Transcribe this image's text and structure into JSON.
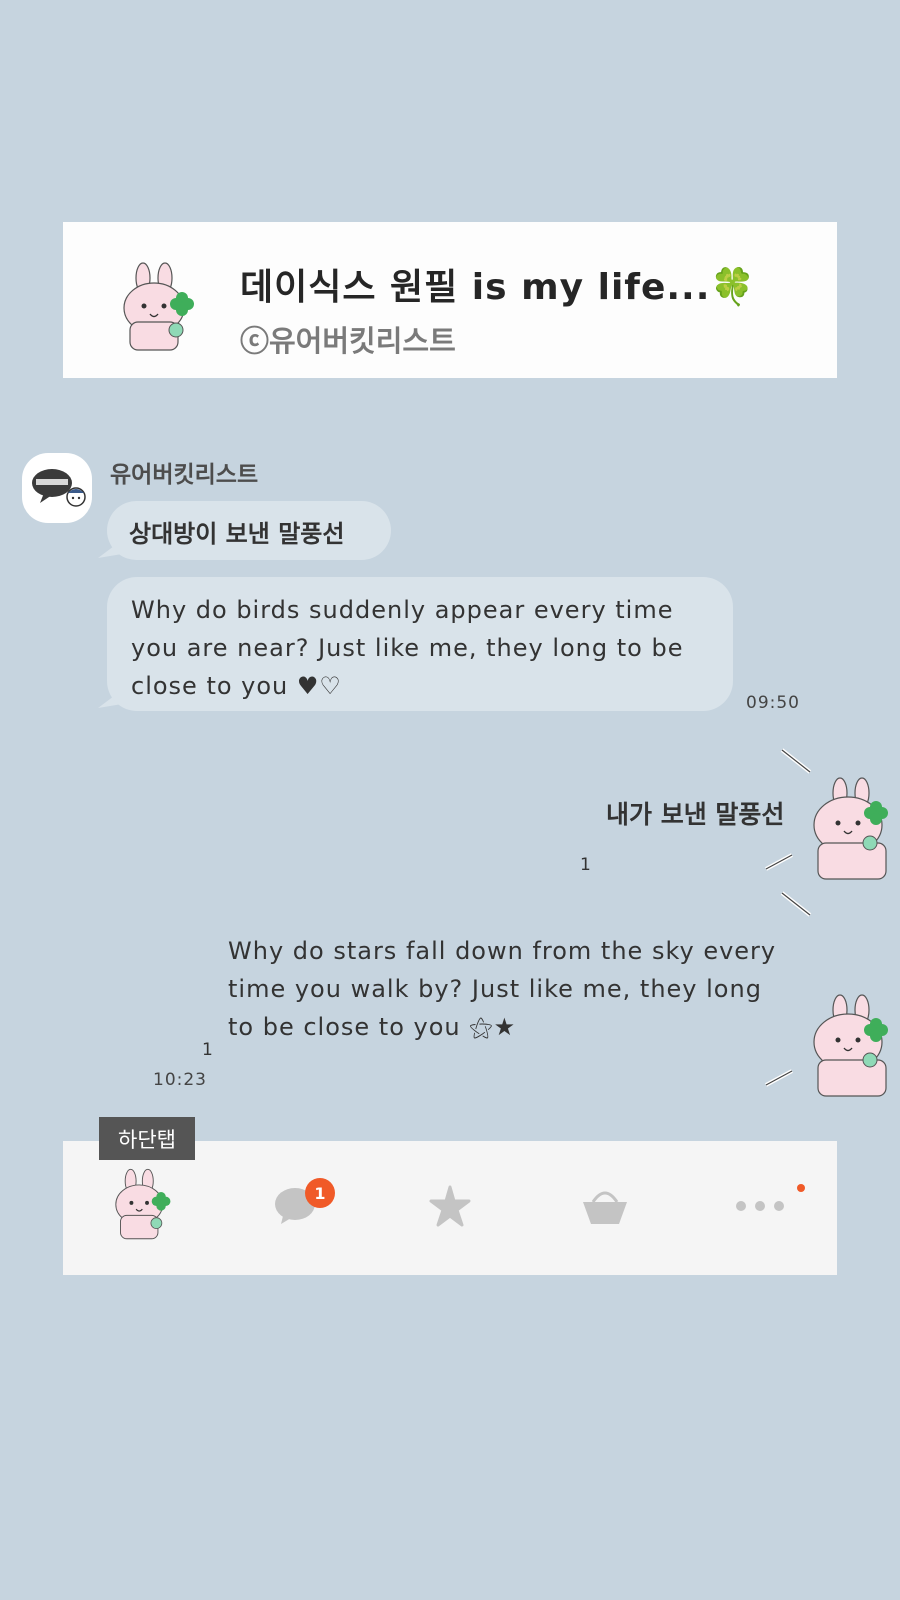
{
  "header": {
    "title": "데이식스 원필 is my life...🍀",
    "copyright": "ⓒ유어버킷리스트"
  },
  "friend": {
    "name": "유어버킷리스트",
    "avatar_text": "your bucketlist",
    "messages": [
      {
        "text": "상대방이 보낸 말풍선"
      },
      {
        "text": "Why do birds suddenly appear every time you are near? Just like me, they long to be close to you ♥♡"
      }
    ],
    "time": "09:50"
  },
  "me": {
    "messages": [
      {
        "text": "내가 보낸 말풍선",
        "read_count": "1"
      },
      {
        "text": "Why do stars fall down from the sky every time you walk by? Just like me, they long to be close to you ⚝★",
        "read_count": "1"
      }
    ],
    "time": "10:23"
  },
  "tab_bar": {
    "label": "하단탭",
    "tabs": [
      {
        "icon": "bunny-profile-icon"
      },
      {
        "icon": "chat-bubble-icon",
        "badge": "1"
      },
      {
        "icon": "star-icon"
      },
      {
        "icon": "shopping-basket-icon"
      },
      {
        "icon": "more-dots-icon",
        "has_new": true
      }
    ]
  },
  "colors": {
    "background": "#c6d4df",
    "bubble": "#d9e3ea",
    "badge": "#f05a28"
  }
}
